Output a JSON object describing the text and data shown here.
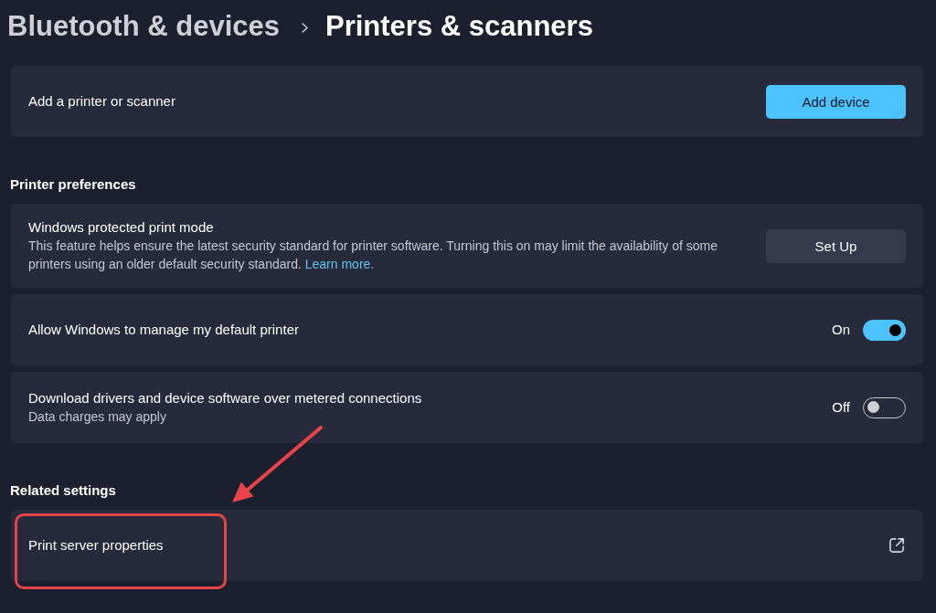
{
  "breadcrumb": [
    {
      "label": "Bluetooth & devices",
      "current": false
    },
    {
      "label": "Printers & scanners",
      "current": true
    }
  ],
  "sections": [
    {
      "items": [
        {
          "kind": "button",
          "title": "Add a printer or scanner",
          "button": {
            "label": "Add device",
            "primary": true
          }
        }
      ]
    },
    {
      "heading": "Printer preferences",
      "items": [
        {
          "kind": "button",
          "title": "Windows protected print mode",
          "description": "This feature helps ensure the latest security standard for printer software. Turning this on may limit the availability of some printers using an older default security standard.",
          "link": "Learn more.",
          "button": {
            "label": "Set Up",
            "primary": false
          }
        },
        {
          "kind": "toggle",
          "title": "Allow Windows to manage my default printer",
          "state_label": "On",
          "on": true
        },
        {
          "kind": "toggle",
          "title": "Download drivers and device software over metered connections",
          "description": "Data charges may apply",
          "state_label": "Off",
          "on": false
        }
      ]
    },
    {
      "heading": "Related settings",
      "items": [
        {
          "kind": "external_link",
          "title": "Print server properties",
          "highlighted": true
        }
      ]
    }
  ]
}
